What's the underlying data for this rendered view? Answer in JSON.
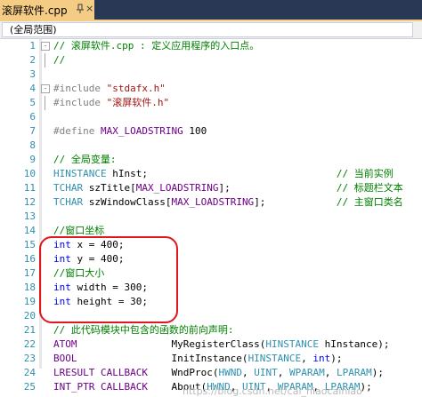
{
  "tab": {
    "title": "滚屏软件.cpp",
    "close_glyph": "×",
    "pin_icon": "pin-icon"
  },
  "navbar": {
    "scope": "(全局范围)"
  },
  "lines": [
    {
      "n": "1",
      "fold": "-",
      "parts": [
        {
          "c": "cm",
          "t": "// 滚屏软件.cpp : 定义应用程序的入口点。"
        }
      ]
    },
    {
      "n": "2",
      "parts": [
        {
          "c": "cm",
          "t": "//"
        }
      ]
    },
    {
      "n": "3",
      "parts": []
    },
    {
      "n": "4",
      "fold": "-",
      "parts": [
        {
          "c": "pp",
          "t": "#include "
        },
        {
          "c": "str",
          "t": "\"stdafx.h\""
        }
      ]
    },
    {
      "n": "5",
      "parts": [
        {
          "c": "pp",
          "t": "#include "
        },
        {
          "c": "str",
          "t": "\"滚屏软件.h\""
        }
      ]
    },
    {
      "n": "6",
      "parts": []
    },
    {
      "n": "7",
      "parts": [
        {
          "c": "pp",
          "t": "#define "
        },
        {
          "c": "mac",
          "t": "MAX_LOADSTRING"
        },
        {
          "c": "tx",
          "t": " 100"
        }
      ]
    },
    {
      "n": "8",
      "parts": []
    },
    {
      "n": "9",
      "parts": [
        {
          "c": "cm",
          "t": "// 全局变量:"
        }
      ]
    },
    {
      "n": "10",
      "parts": [
        {
          "c": "ty",
          "t": "HINSTANCE"
        },
        {
          "c": "tx",
          "t": " hInst;                                "
        },
        {
          "c": "cm",
          "t": "// 当前实例"
        }
      ]
    },
    {
      "n": "11",
      "parts": [
        {
          "c": "ty",
          "t": "TCHAR"
        },
        {
          "c": "tx",
          "t": " szTitle["
        },
        {
          "c": "mac",
          "t": "MAX_LOADSTRING"
        },
        {
          "c": "tx",
          "t": "];                  "
        },
        {
          "c": "cm",
          "t": "// 标题栏文本"
        }
      ]
    },
    {
      "n": "12",
      "parts": [
        {
          "c": "ty",
          "t": "TCHAR"
        },
        {
          "c": "tx",
          "t": " szWindowClass["
        },
        {
          "c": "mac",
          "t": "MAX_LOADSTRING"
        },
        {
          "c": "tx",
          "t": "];            "
        },
        {
          "c": "cm",
          "t": "// 主窗口类名"
        }
      ]
    },
    {
      "n": "13",
      "parts": []
    },
    {
      "n": "14",
      "parts": [
        {
          "c": "cm",
          "t": "//窗口坐标"
        }
      ]
    },
    {
      "n": "15",
      "parts": [
        {
          "c": "kw",
          "t": "int"
        },
        {
          "c": "tx",
          "t": " x = 400;"
        }
      ]
    },
    {
      "n": "16",
      "parts": [
        {
          "c": "kw",
          "t": "int"
        },
        {
          "c": "tx",
          "t": " y = 400;"
        }
      ]
    },
    {
      "n": "17",
      "parts": [
        {
          "c": "cm",
          "t": "//窗口大小"
        }
      ]
    },
    {
      "n": "18",
      "parts": [
        {
          "c": "kw",
          "t": "int"
        },
        {
          "c": "tx",
          "t": " width = 300;"
        }
      ]
    },
    {
      "n": "19",
      "parts": [
        {
          "c": "kw",
          "t": "int"
        },
        {
          "c": "tx",
          "t": " height = 30;"
        }
      ]
    },
    {
      "n": "20",
      "parts": []
    },
    {
      "n": "21",
      "parts": [
        {
          "c": "cm",
          "t": "// 此代码模块中包含的函数的前向声明:"
        }
      ]
    },
    {
      "n": "22",
      "parts": [
        {
          "c": "mac",
          "t": "ATOM"
        },
        {
          "c": "tx",
          "t": "                MyRegisterClass("
        },
        {
          "c": "ty",
          "t": "HINSTANCE"
        },
        {
          "c": "tx",
          "t": " hInstance);"
        }
      ]
    },
    {
      "n": "23",
      "parts": [
        {
          "c": "mac",
          "t": "BOOL"
        },
        {
          "c": "tx",
          "t": "                InitInstance("
        },
        {
          "c": "ty",
          "t": "HINSTANCE"
        },
        {
          "c": "tx",
          "t": ", "
        },
        {
          "c": "kw",
          "t": "int"
        },
        {
          "c": "tx",
          "t": ");"
        }
      ]
    },
    {
      "n": "24",
      "parts": [
        {
          "c": "mac",
          "t": "LRESULT CALLBACK"
        },
        {
          "c": "tx",
          "t": "    WndProc("
        },
        {
          "c": "ty",
          "t": "HWND"
        },
        {
          "c": "tx",
          "t": ", "
        },
        {
          "c": "ty",
          "t": "UINT"
        },
        {
          "c": "tx",
          "t": ", "
        },
        {
          "c": "ty",
          "t": "WPARAM"
        },
        {
          "c": "tx",
          "t": ", "
        },
        {
          "c": "ty",
          "t": "LPARAM"
        },
        {
          "c": "tx",
          "t": ");"
        }
      ]
    },
    {
      "n": "25",
      "parts": [
        {
          "c": "mac",
          "t": "INT_PTR CALLBACK"
        },
        {
          "c": "tx",
          "t": "    About("
        },
        {
          "c": "ty",
          "t": "HWND"
        },
        {
          "c": "tx",
          "t": ", "
        },
        {
          "c": "ty",
          "t": "UINT"
        },
        {
          "c": "tx",
          "t": ", "
        },
        {
          "c": "ty",
          "t": "WPARAM"
        },
        {
          "c": "tx",
          "t": ", "
        },
        {
          "c": "ty",
          "t": "LPARAM"
        },
        {
          "c": "tx",
          "t": ");"
        }
      ]
    }
  ],
  "watermark": "https://blog.csdn.net/cai_niaocainiao",
  "colors": {
    "tab_active": "#f5cc84",
    "tabstrip_bg": "#293955",
    "line_number": "#2b91af",
    "comment": "#008000",
    "keyword": "#0000ff",
    "string": "#a31515",
    "macro": "#6f008a",
    "highlight_annotation": "#e0171c"
  }
}
